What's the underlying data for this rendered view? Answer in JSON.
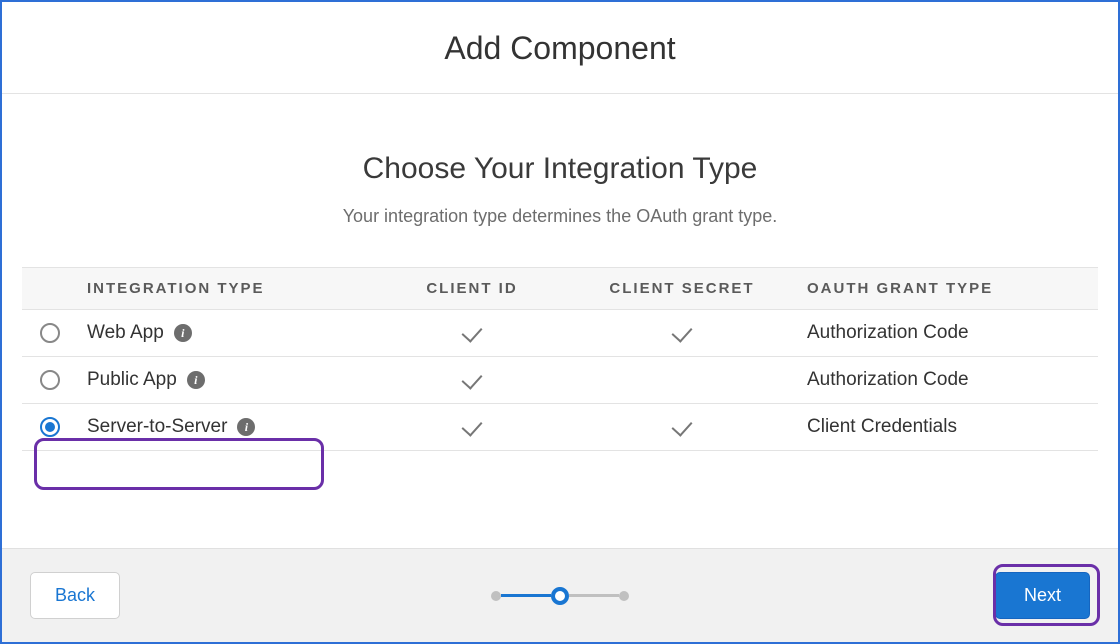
{
  "header": {
    "title": "Add Component"
  },
  "subheader": {
    "title": "Choose Your Integration Type",
    "desc": "Your integration type determines the OAuth grant type."
  },
  "table": {
    "columns": {
      "type": "INTEGRATION TYPE",
      "client_id": "CLIENT ID",
      "client_secret": "CLIENT SECRET",
      "grant": "OAUTH GRANT TYPE"
    },
    "rows": [
      {
        "label": "Web App",
        "client_id": true,
        "client_secret": true,
        "grant": "Authorization Code",
        "selected": false
      },
      {
        "label": "Public App",
        "client_id": true,
        "client_secret": false,
        "grant": "Authorization Code",
        "selected": false
      },
      {
        "label": "Server-to-Server",
        "client_id": true,
        "client_secret": true,
        "grant": "Client Credentials",
        "selected": true
      }
    ]
  },
  "footer": {
    "back": "Back",
    "next": "Next"
  }
}
